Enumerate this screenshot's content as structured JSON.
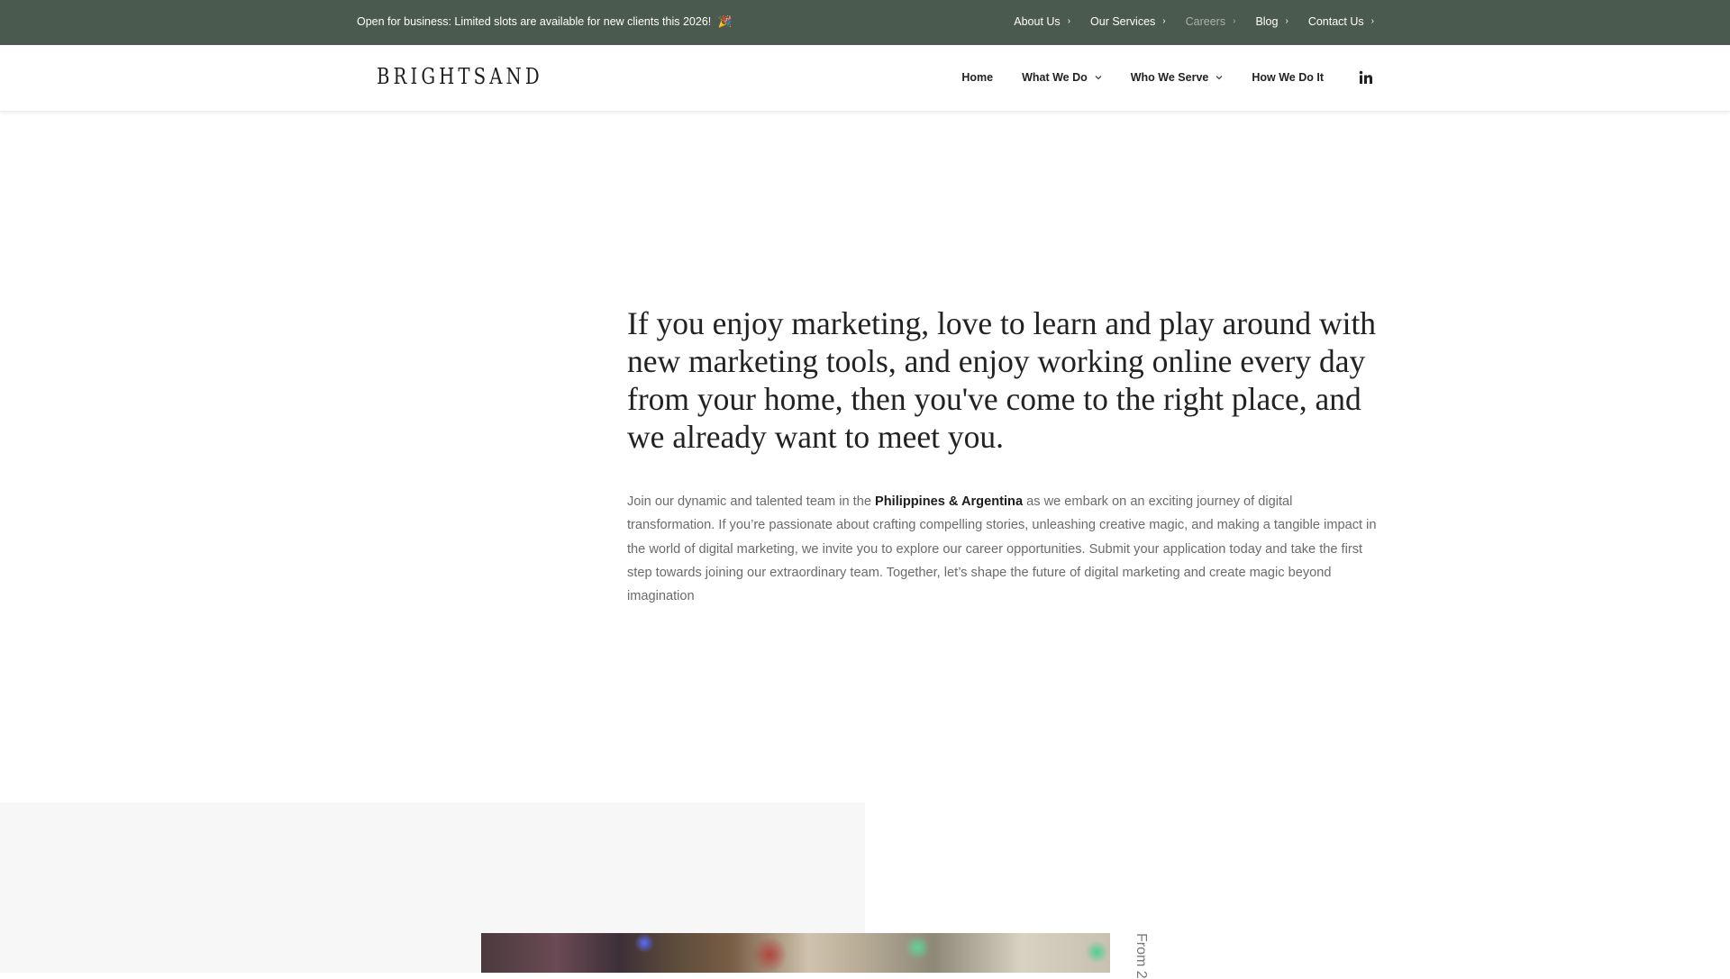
{
  "topbar": {
    "announcement": "Open for business: Limited slots are available for new clients this 2026!",
    "announcement_emoji": "🎉",
    "background": "#4b5a4e",
    "nav": [
      {
        "label": "About Us",
        "active": false
      },
      {
        "label": "Our Services",
        "active": false
      },
      {
        "label": "Careers",
        "active": true
      },
      {
        "label": "Blog",
        "active": false
      },
      {
        "label": "Contact Us",
        "active": false
      }
    ],
    "chevron_icon": "›"
  },
  "header": {
    "logo_text": "BRIGHTSAND",
    "nav": [
      {
        "label": "Home",
        "has_dropdown": false
      },
      {
        "label": "What We Do",
        "has_dropdown": true
      },
      {
        "label": "Who We Serve",
        "has_dropdown": true
      },
      {
        "label": "How We Do It",
        "has_dropdown": false
      }
    ],
    "caret_icon": "⌄",
    "social_icon": "linkedin-icon"
  },
  "hero": {
    "heading": "If you enjoy marketing, love to learn and play around with new marketing tools, and enjoy working online every day from your home, then you've come to the right place, and we already want to meet you.",
    "body_before": "Join our dynamic and talented team in the ",
    "body_highlight": "Philippines & Argentina",
    "body_after": " as we embark on an exciting journey of digital transformation. If you’re passionate about crafting compelling stories, unleashing creative magic, and making a tangible impact in the world of digital marketing, we invite you to explore our career opportunities. Submit your application today and take the first step towards joining our extraordinary team. Together, let’s shape the future of digital marketing and create magic beyond imagination"
  },
  "lower": {
    "vertical_label": "From 2"
  }
}
